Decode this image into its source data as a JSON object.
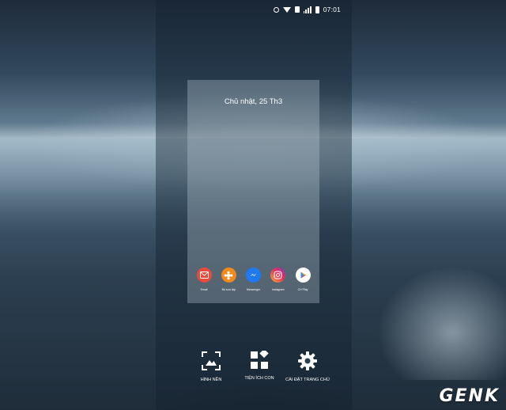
{
  "status_bar": {
    "time": "07:01",
    "icons": [
      "alarm-icon",
      "wifi-icon",
      "nfc-icon",
      "signal-icon",
      "battery-icon"
    ]
  },
  "preview": {
    "date": "Chủ nhật, 25 Th3",
    "apps": [
      {
        "label": "Email",
        "icon": "email-icon",
        "color": "#e84a3c"
      },
      {
        "label": "Bộ sưu tập",
        "icon": "gallery-icon",
        "color": "#f08a1c"
      },
      {
        "label": "Messenger",
        "icon": "messenger-icon",
        "color": "#1f7af0"
      },
      {
        "label": "Instagram",
        "icon": "instagram-icon",
        "color": "#c13584"
      },
      {
        "label": "CH Play",
        "icon": "play-store-icon",
        "color": "#ffffff"
      }
    ]
  },
  "actions": [
    {
      "label": "HÌNH NỀN",
      "icon": "wallpaper-icon"
    },
    {
      "label": "TIỆN ÍCH CON",
      "icon": "widgets-icon"
    },
    {
      "label": "CÀI ĐẶT TRANG CHỦ",
      "icon": "gear-icon"
    }
  ],
  "watermark": {
    "text": "GENK"
  }
}
